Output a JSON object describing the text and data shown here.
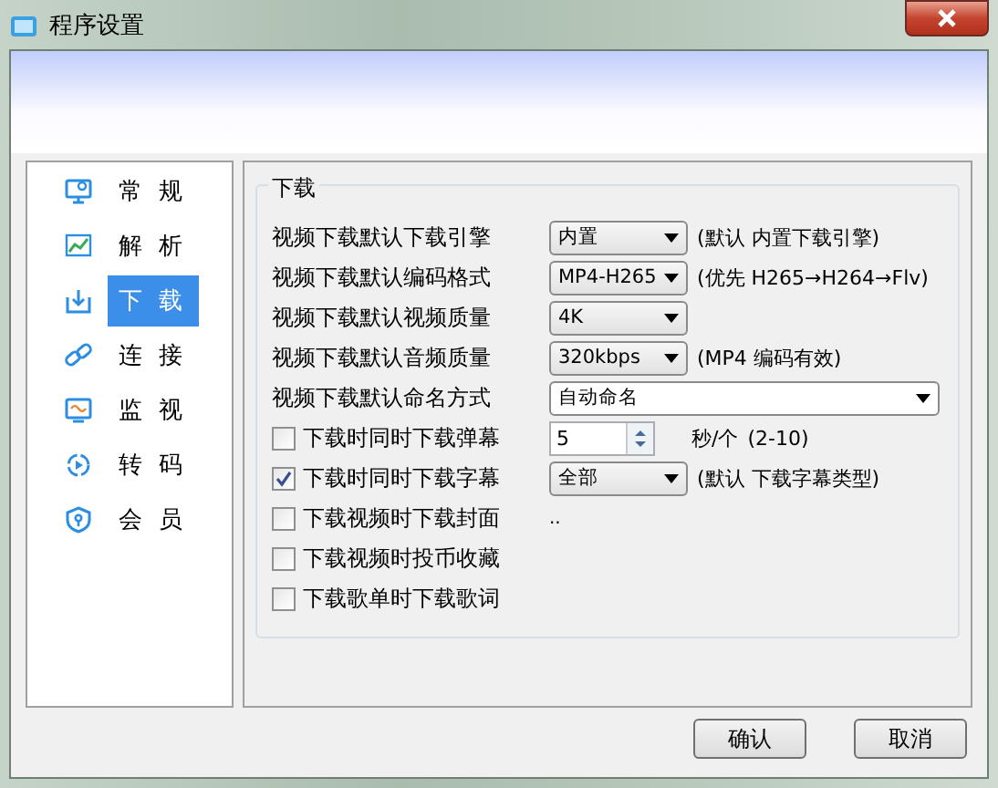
{
  "window": {
    "title": "程序设置"
  },
  "sidebar": {
    "items": [
      {
        "label": "常规",
        "selected": false
      },
      {
        "label": "解析",
        "selected": false
      },
      {
        "label": "下载",
        "selected": true
      },
      {
        "label": "连接",
        "selected": false
      },
      {
        "label": "监视",
        "selected": false
      },
      {
        "label": "转码",
        "selected": false
      },
      {
        "label": "会员",
        "selected": false
      }
    ]
  },
  "group": {
    "title": "下载",
    "rows": [
      {
        "kind": "select",
        "label": "视频下载默认下载引擎",
        "value": "内置",
        "hint": "(默认 内置下载引擎)"
      },
      {
        "kind": "select",
        "label": "视频下载默认编码格式",
        "value": "MP4-H265",
        "hint": "(优先 H265→H264→Flv)"
      },
      {
        "kind": "select",
        "label": "视频下载默认视频质量",
        "value": "4K"
      },
      {
        "kind": "select",
        "label": "视频下载默认音频质量",
        "value": "320kbps",
        "hint": "(MP4 编码有效)"
      },
      {
        "kind": "wide_select",
        "label": "视频下载默认命名方式",
        "value": "自动命名"
      },
      {
        "kind": "check_spin",
        "label": "下载时同时下载弹幕",
        "checked": false,
        "value": "5",
        "unit": "秒/个",
        "hint": "(2-10)"
      },
      {
        "kind": "check_select",
        "label": "下载时同时下载字幕",
        "checked": true,
        "value": "全部",
        "hint": "(默认 下载字幕类型)"
      },
      {
        "kind": "check",
        "label": "下载视频时下载封面",
        "checked": false,
        "hint": ".."
      },
      {
        "kind": "check",
        "label": "下载视频时投币收藏",
        "checked": false
      },
      {
        "kind": "check",
        "label": "下载歌单时下载歌词",
        "checked": false
      }
    ]
  },
  "buttons": [
    "确认",
    "取消"
  ]
}
